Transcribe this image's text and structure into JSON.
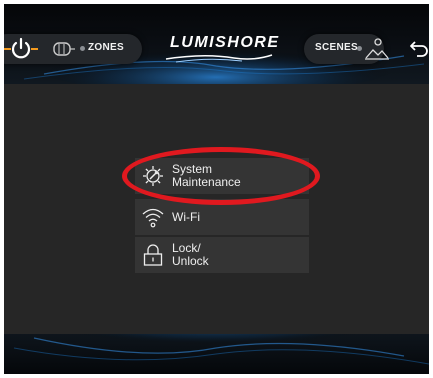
{
  "header": {
    "zones_label": "ZONES",
    "logo_text": "LUMISHORE",
    "scenes_label": "SCENES",
    "icons": {
      "power": "power-icon",
      "zones": "zones-light-icon",
      "scenes": "scenes-landscape-icon",
      "back": "back-arrow-icon"
    }
  },
  "menu": {
    "items": [
      {
        "lines": [
          "System",
          "Maintenance"
        ],
        "icon": "wrench-gear-icon"
      },
      {
        "lines": [
          "Wi-Fi"
        ],
        "icon": "wifi-icon"
      },
      {
        "lines": [
          "Lock/",
          "Unlock"
        ],
        "icon": "lock-icon"
      }
    ]
  },
  "colors": {
    "accent_orange": "#f39a1e",
    "background": "#262626",
    "button": "#343434",
    "glow_blue": "#1f7fd6",
    "annotation_red": "#e0191f"
  }
}
